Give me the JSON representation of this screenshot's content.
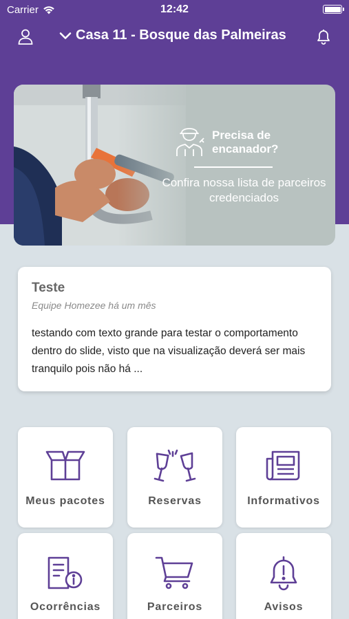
{
  "status_bar": {
    "carrier": "Carrier",
    "time": "12:42"
  },
  "header": {
    "location": "Casa 11 - Bosque das Palmeiras"
  },
  "banner": {
    "headline": "Precisa de encanador?",
    "subline": "Confira nossa lista de parceiros credenciados"
  },
  "news": {
    "title": "Teste",
    "meta": "Equipe Homezee há um mês",
    "body": "testando com texto grande para testar o comportamento dentro do slide, visto que na visualização deverá ser mais tranquilo pois não há ..."
  },
  "tiles": [
    {
      "label": "Meus pacotes",
      "icon": "package-icon"
    },
    {
      "label": "Reservas",
      "icon": "wine-glasses-icon"
    },
    {
      "label": "Informativos",
      "icon": "newspaper-icon"
    },
    {
      "label": "Ocorrências",
      "icon": "document-info-icon"
    },
    {
      "label": "Parceiros",
      "icon": "shopping-cart-icon"
    },
    {
      "label": "Avisos",
      "icon": "bell-alert-icon"
    }
  ],
  "colors": {
    "primary": "#5e3f96",
    "background": "#d9e1e6",
    "icon": "#5e3f96"
  }
}
